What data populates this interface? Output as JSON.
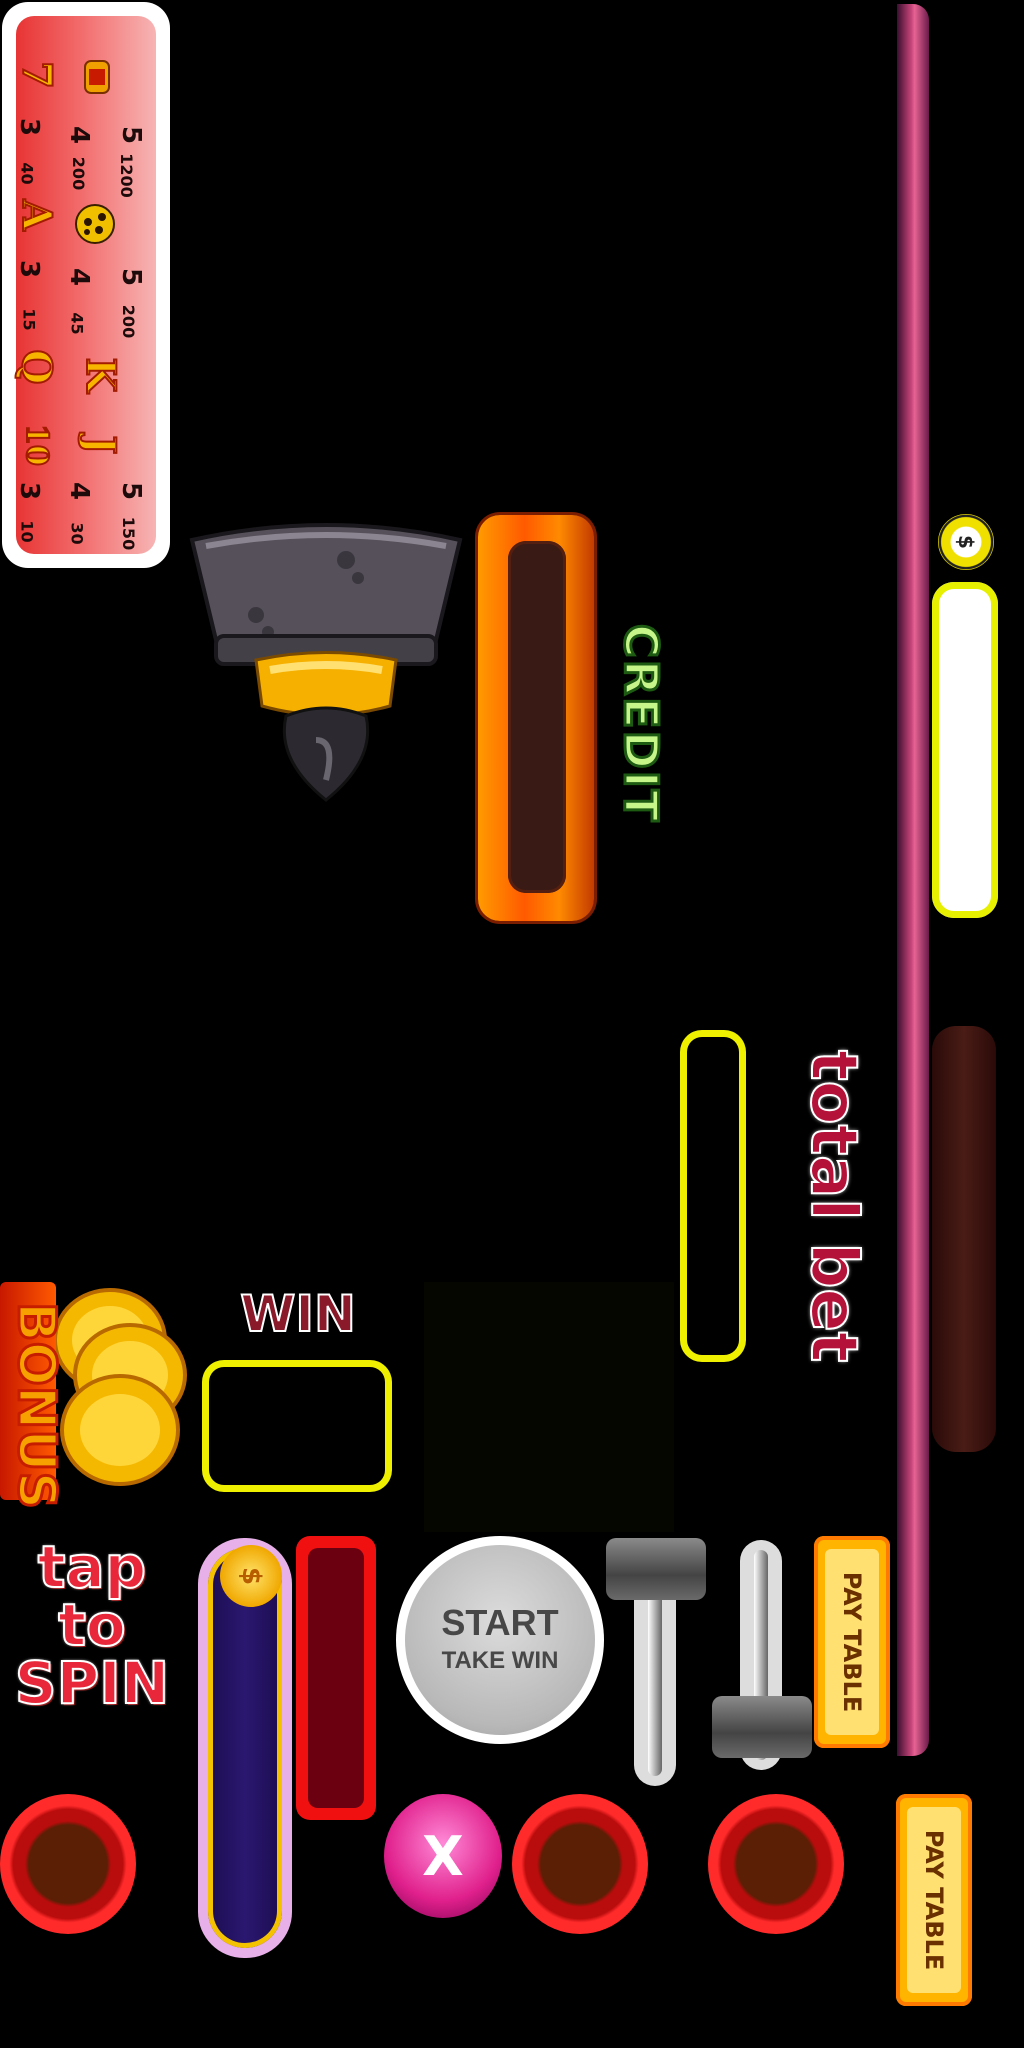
{
  "paytable": {
    "rows": [
      {
        "symbol": "barrel-icon",
        "counts": [
          "5",
          "4",
          "3"
        ],
        "payouts": [
          "1200",
          "200",
          "40"
        ]
      },
      {
        "symbol": "leopard-icon",
        "counts": [
          "5",
          "4",
          "3"
        ],
        "payouts": [
          "200",
          "45",
          "15"
        ]
      },
      {
        "symbol_letters": [
          "K",
          "J"
        ],
        "counts": [
          "5",
          "4",
          "3"
        ],
        "payouts": [
          "150",
          "30",
          "10"
        ]
      }
    ],
    "left_symbols": [
      "7",
      "A",
      "Q",
      "10"
    ],
    "left_counts": [
      "3",
      "3",
      "3",
      "3"
    ]
  },
  "credit": {
    "label": "CREDIT"
  },
  "total_bet": {
    "label": "total bet"
  },
  "win": {
    "label": "WIN"
  },
  "bonus": {
    "label": "BONUS"
  },
  "tap_to_spin": {
    "line1": "tap",
    "line2": "to",
    "line3": "SPIN"
  },
  "start_button": {
    "label": "START",
    "sublabel": "TAKE WIN"
  },
  "pay_table_button": {
    "label": "PAY TABLE"
  },
  "close_button": {
    "label": "X"
  },
  "coin": {
    "glyph": "$"
  }
}
